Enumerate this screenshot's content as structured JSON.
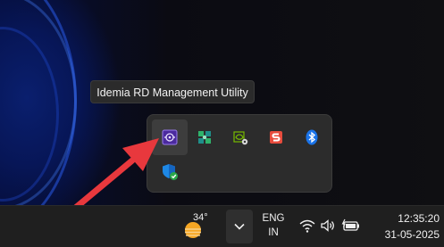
{
  "tooltip": {
    "text": "Idemia RD Management Utility"
  },
  "tray_flyout": {
    "icons": [
      {
        "name": "idemia-rd-icon"
      },
      {
        "name": "green-app-icon"
      },
      {
        "name": "nvidia-icon"
      },
      {
        "name": "s-app-icon"
      },
      {
        "name": "bluetooth-icon"
      },
      {
        "name": "security-shield-icon"
      }
    ]
  },
  "taskbar": {
    "weather": {
      "temperature": "34°",
      "icon": "weather-sun-icon"
    },
    "language": {
      "line1": "ENG",
      "line2": "IN"
    },
    "clock": {
      "time": "12:35:20",
      "date": "31-05-2025"
    }
  },
  "colors": {
    "annotation_arrow": "#e8383d",
    "idemia_purple": "#4b2a9e",
    "bluetooth_blue": "#1a73e8"
  }
}
